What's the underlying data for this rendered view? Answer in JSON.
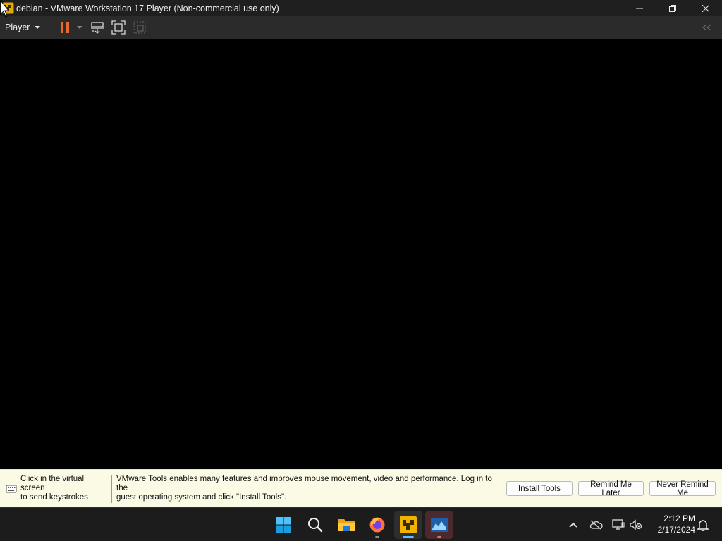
{
  "window": {
    "title": "debian - VMware Workstation 17 Player (Non-commercial use only)",
    "controls": [
      "minimize",
      "restore",
      "close"
    ]
  },
  "toolbar": {
    "player_menu_label": "Player",
    "buttons": [
      {
        "name": "pause-icon",
        "color": "#e86a2c"
      },
      {
        "name": "send-ctrl-alt-del-icon"
      },
      {
        "name": "full-screen-icon"
      },
      {
        "name": "unity-icon",
        "state": "disabled"
      },
      {
        "name": "library-collapse-icon"
      }
    ]
  },
  "notification": {
    "hint_line1": "Click in the virtual screen",
    "hint_line2": "to send keystrokes",
    "message_line1": "VMware Tools enables many features and improves mouse movement, video and performance. Log in to the",
    "message_line2": "guest operating system and click \"Install Tools\".",
    "install_label": "Install Tools",
    "remind_later_label": "Remind Me Later",
    "never_remind_label": "Never Remind Me",
    "background_color": "#fbfbe5"
  },
  "taskbar": {
    "apps": [
      {
        "name": "start-windows-icon"
      },
      {
        "name": "search-icon"
      },
      {
        "name": "file-explorer-icon"
      },
      {
        "name": "firefox-icon",
        "running": true
      },
      {
        "name": "vmware-player-icon",
        "running": true,
        "focused": true
      },
      {
        "name": "system-monitor-icon",
        "running": true
      }
    ],
    "tray": [
      "chevron-up-icon",
      "onedrive-offline-icon",
      "network-icon",
      "volume-muted-icon",
      "notification-bell-icon"
    ],
    "clock": {
      "time": "2:12 PM",
      "date": "2/17/2024"
    }
  }
}
